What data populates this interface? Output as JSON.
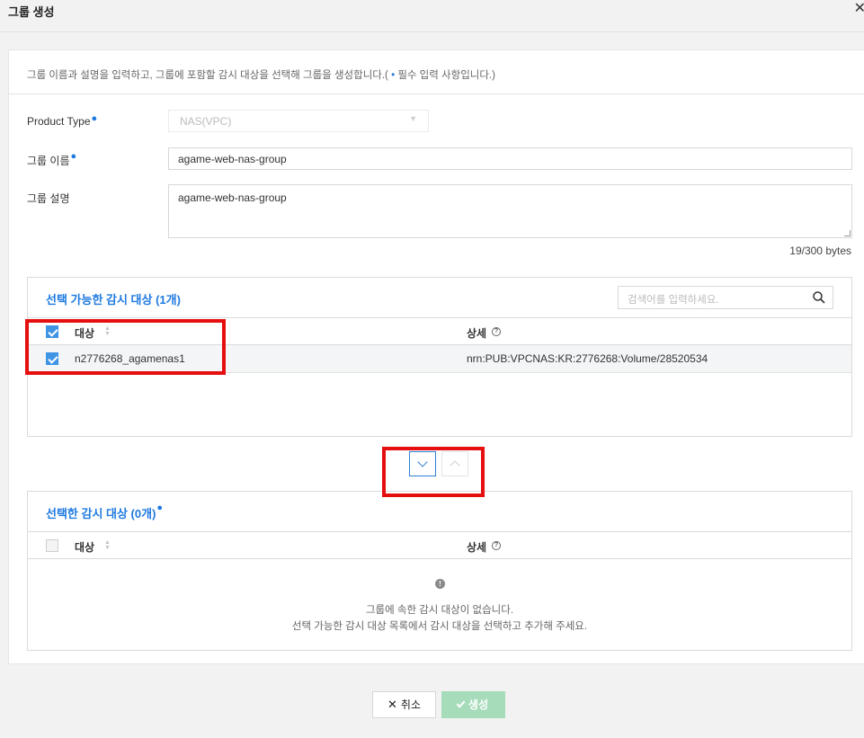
{
  "dialog": {
    "title": "그룹 생성",
    "close_icon": "close-icon",
    "description": "그룹 이름과 설명을 입력하고, 그룹에 포함할 감시 대상을 선택해 그룹을 생성합니다.(",
    "description_req": "필수 입력 사항입니다.)"
  },
  "form": {
    "product_type_label": "Product Type",
    "product_type_value": "NAS(VPC)",
    "group_name_label": "그룹 이름",
    "group_name_value": "agame-web-nas-group",
    "group_desc_label": "그룹 설명",
    "group_desc_value": "agame-web-nas-group",
    "byte_count": "19/300 bytes"
  },
  "available": {
    "title": "선택 가능한 감시 대상 (1개)",
    "search_placeholder": "검색어를 입력하세요.",
    "col_target": "대상",
    "col_detail": "상세",
    "rows": [
      {
        "name": "n2776268_agamenas1",
        "detail": "nrn:PUB:VPCNAS:KR:2776268:Volume/28520534",
        "checked": true
      }
    ]
  },
  "selected": {
    "title": "선택한 감시 대상 (0개)",
    "col_target": "대상",
    "col_detail": "상세",
    "empty_line1": "그룹에 속한 감시 대상이 없습니다.",
    "empty_line2": "선택 가능한 감시 대상 목록에서 감시 대상을 선택하고 추가해 주세요."
  },
  "actions": {
    "cancel_label": "취소",
    "create_label": "생성"
  },
  "colors": {
    "accent": "#1f7ae0",
    "highlight": "#e50f0f",
    "create_disabled": "#a7dcbb"
  }
}
